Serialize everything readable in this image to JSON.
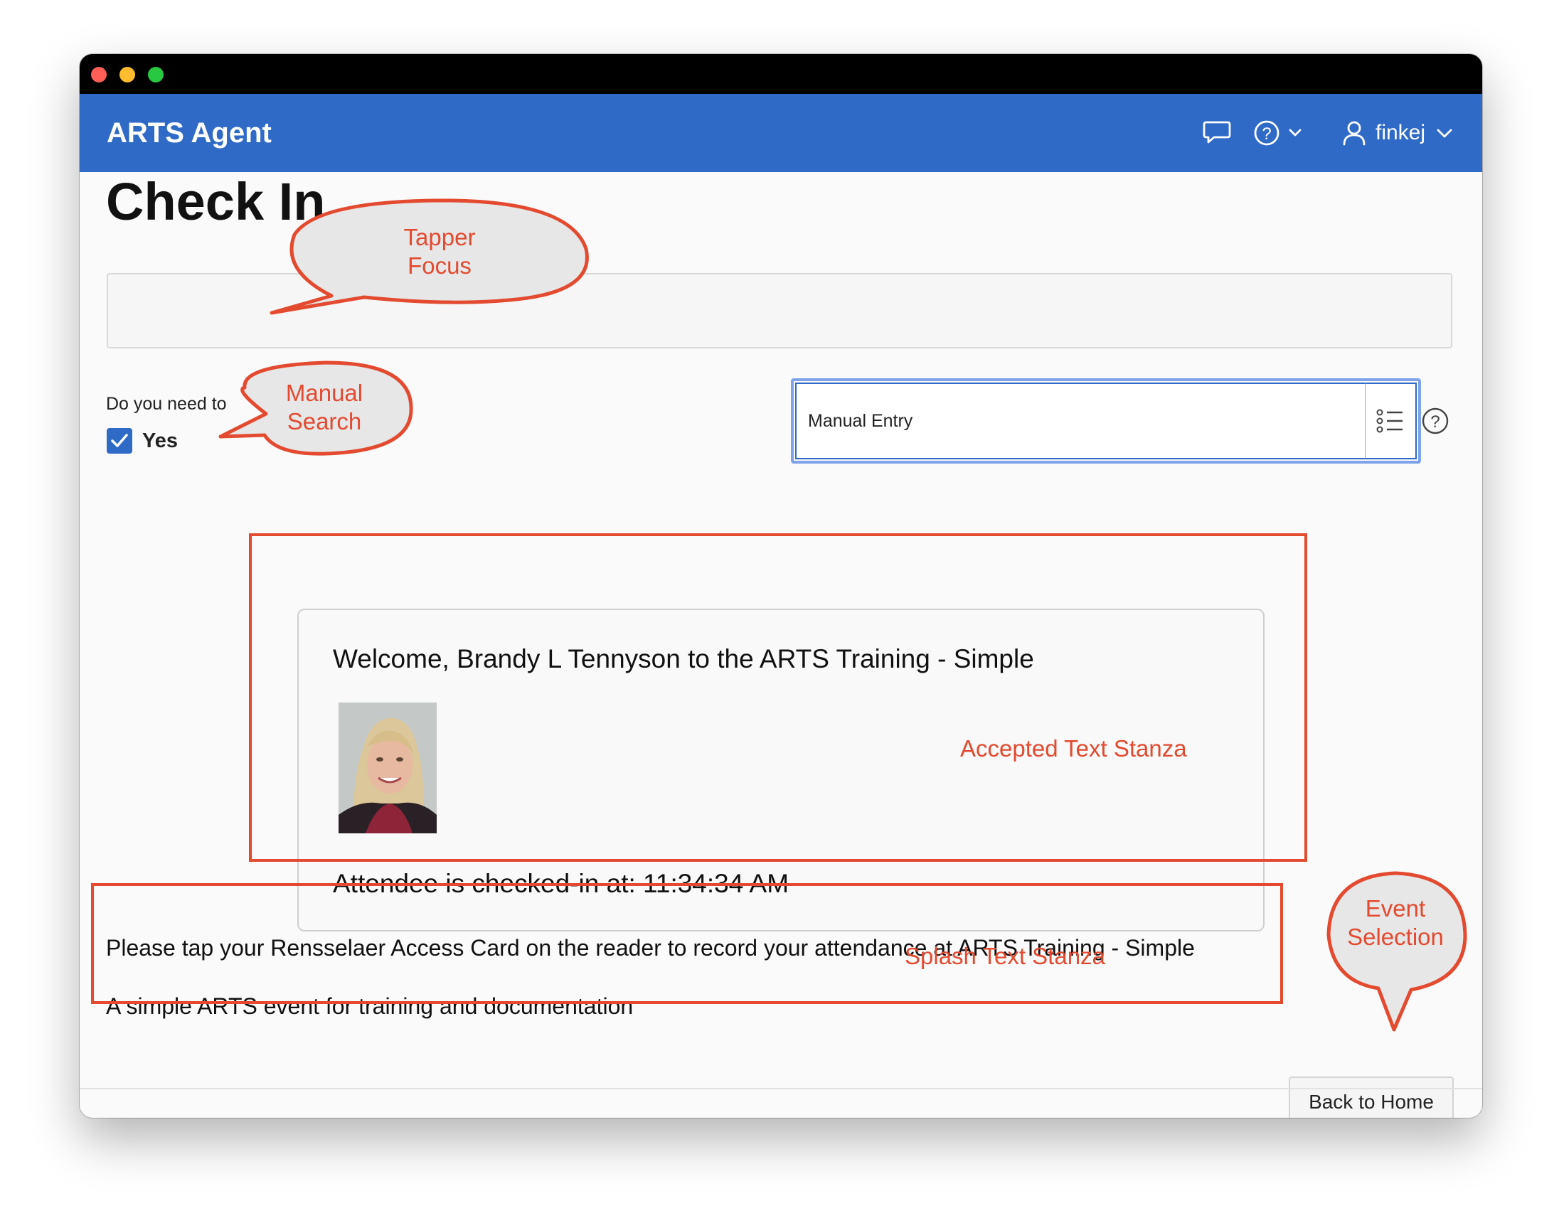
{
  "app": {
    "title": "ARTS Agent",
    "user": "finkej"
  },
  "page": {
    "title": "Check In"
  },
  "manual_search": {
    "question": "Do you need to",
    "checkbox_label": "Yes",
    "checked": true
  },
  "entry_field": {
    "value": "Manual Entry"
  },
  "accepted_card": {
    "welcome": "Welcome, Brandy L Tennyson to the ARTS Training - Simple",
    "checked_in": "Attendee is checked-in at: 11:34:34 AM"
  },
  "splash": {
    "line1": "Please tap your Rensselaer Access Card on the reader to record your attendance at ARTS Training - Simple",
    "line2": "A simple ARTS event for training and documentation"
  },
  "buttons": {
    "back_home": "Back to Home"
  },
  "annotations": {
    "tapper_focus": [
      "Tapper",
      "Focus"
    ],
    "manual_search": [
      "Manual",
      "Search"
    ],
    "event_selection": [
      "Event",
      "Selection"
    ],
    "accepted_text": "Accepted Text Stanza",
    "splash_text": "Splash Text Stanza"
  },
  "colors": {
    "header_blue": "#2e6ac6",
    "annotation_red": "#e34a2f"
  }
}
